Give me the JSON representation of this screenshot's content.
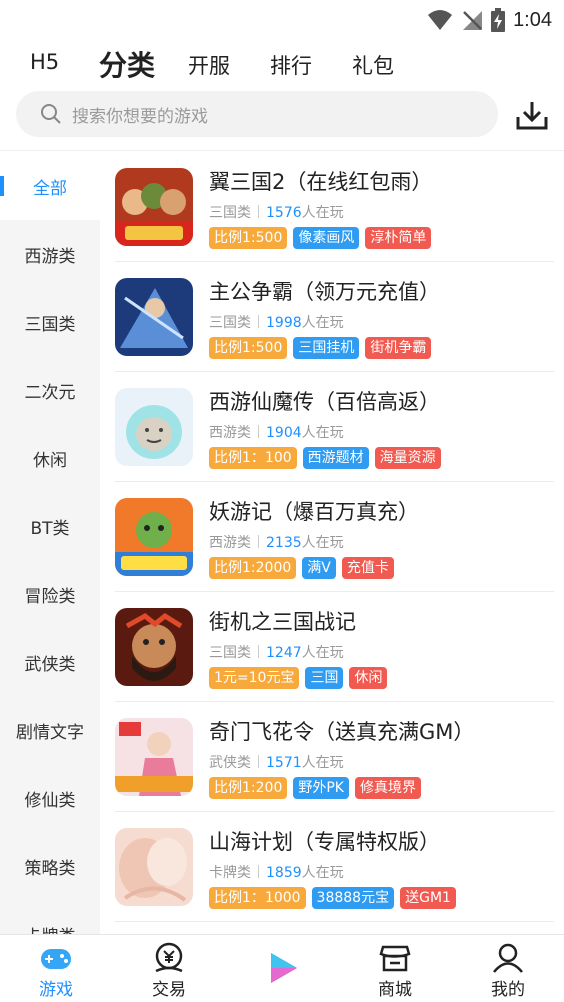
{
  "status_bar": {
    "time": "1:04"
  },
  "top_tabs": [
    {
      "label": "H5"
    },
    {
      "label": "分类"
    },
    {
      "label": "开服"
    },
    {
      "label": "排行"
    },
    {
      "label": "礼包"
    }
  ],
  "search": {
    "placeholder": "搜索你想要的游戏"
  },
  "sidebar": {
    "items": [
      {
        "label": "全部"
      },
      {
        "label": "西游类"
      },
      {
        "label": "三国类"
      },
      {
        "label": "二次元"
      },
      {
        "label": "休闲"
      },
      {
        "label": "BT类"
      },
      {
        "label": "冒险类"
      },
      {
        "label": "武侠类"
      },
      {
        "label": "剧情文字"
      },
      {
        "label": "修仙类"
      },
      {
        "label": "策略类"
      },
      {
        "label": "卡牌类"
      }
    ]
  },
  "games": [
    {
      "title": "翼三国2（在线红包雨）",
      "category": "三国类",
      "players": "1576",
      "players_suffix": "人在玩",
      "tags": [
        {
          "text": "比例1:500",
          "color": "orange"
        },
        {
          "text": "像素画风",
          "color": "blue"
        },
        {
          "text": "淳朴简单",
          "color": "red"
        }
      ]
    },
    {
      "title": "主公争霸（领万元充值）",
      "category": "三国类",
      "players": "1998",
      "players_suffix": "人在玩",
      "tags": [
        {
          "text": "比例1:500",
          "color": "orange"
        },
        {
          "text": "三国挂机",
          "color": "blue"
        },
        {
          "text": "街机争霸",
          "color": "red"
        }
      ]
    },
    {
      "title": "西游仙魔传（百倍高返）",
      "category": "西游类",
      "players": "1904",
      "players_suffix": "人在玩",
      "tags": [
        {
          "text": "比例1：100",
          "color": "orange"
        },
        {
          "text": "西游题材",
          "color": "blue"
        },
        {
          "text": "海量资源",
          "color": "red"
        }
      ]
    },
    {
      "title": "妖游记（爆百万真充）",
      "category": "西游类",
      "players": "2135",
      "players_suffix": "人在玩",
      "tags": [
        {
          "text": "比例1:2000",
          "color": "orange"
        },
        {
          "text": "满V",
          "color": "blue"
        },
        {
          "text": "充值卡",
          "color": "red"
        }
      ]
    },
    {
      "title": "街机之三国战记",
      "category": "三国类",
      "players": "1247",
      "players_suffix": "人在玩",
      "tags": [
        {
          "text": "1元=10元宝",
          "color": "orange"
        },
        {
          "text": "三国",
          "color": "blue"
        },
        {
          "text": "休闲",
          "color": "red"
        }
      ]
    },
    {
      "title": "奇门飞花令（送真充满GM）",
      "category": "武侠类",
      "players": "1571",
      "players_suffix": "人在玩",
      "tags": [
        {
          "text": "比例1:200",
          "color": "orange"
        },
        {
          "text": "野外PK",
          "color": "blue"
        },
        {
          "text": "修真境界",
          "color": "red"
        }
      ]
    },
    {
      "title": "山海计划（专属特权版）",
      "category": "卡牌类",
      "players": "1859",
      "players_suffix": "人在玩",
      "tags": [
        {
          "text": "比例1：1000",
          "color": "orange"
        },
        {
          "text": "38888元宝",
          "color": "blue"
        },
        {
          "text": "送GM1",
          "color": "red"
        }
      ]
    }
  ],
  "bottom_nav": [
    {
      "label": "游戏",
      "icon": "gamepad-icon"
    },
    {
      "label": "交易",
      "icon": "trade-icon"
    },
    {
      "label": "",
      "icon": "play-icon"
    },
    {
      "label": "商城",
      "icon": "store-icon"
    },
    {
      "label": "我的",
      "icon": "profile-icon"
    }
  ],
  "colors": {
    "accent": "#1e90ff",
    "tag_orange": "#f7a93b",
    "tag_blue": "#2f9cf2",
    "tag_red": "#f15a50"
  }
}
